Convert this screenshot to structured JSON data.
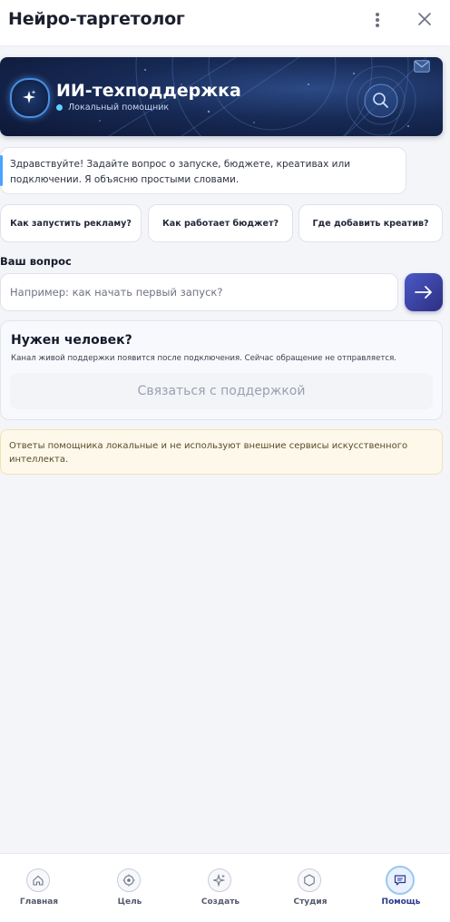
{
  "header": {
    "title": "Нейро-таргетолог",
    "menu_icon": "kebab-icon",
    "close_icon": "close-icon"
  },
  "banner": {
    "title": "ИИ-техподдержка",
    "status": "Локальный помощник",
    "badge_icon": "sparkle-icon"
  },
  "greeting": {
    "text": "Здравствуйте! Задайте вопрос о запуске, бюджете, креативах или подключении. Я объясню простыми словами."
  },
  "suggestions": [
    {
      "label": "Как запустить рекламу?"
    },
    {
      "label": "Как работает бюджет?"
    },
    {
      "label": "Где добавить креатив?"
    }
  ],
  "question": {
    "label": "Ваш вопрос",
    "value": "",
    "placeholder": "Например: как начать первый запуск?",
    "send_icon": "arrow-right-icon"
  },
  "human": {
    "title": "Нужен человек?",
    "subtitle": "Канал живой поддержки появится после подключения. Сейчас обращение не отправляется.",
    "button": "Связаться с поддержкой"
  },
  "notice": {
    "text": "Ответы помощника локальные и не используют внешние сервисы искусственного интеллекта."
  },
  "nav": {
    "items": [
      {
        "label": "Главная",
        "icon": "home-icon"
      },
      {
        "label": "Цель",
        "icon": "target-icon"
      },
      {
        "label": "Создать",
        "icon": "sparkle-icon"
      },
      {
        "label": "Студия",
        "icon": "hexagon-icon"
      },
      {
        "label": "Помощь",
        "icon": "chat-icon"
      }
    ],
    "active": "Помощь"
  },
  "colors": {
    "accent": "#2a3a8f",
    "banner_bg": "#172a55",
    "notice_bg": "#fdf8ea"
  }
}
